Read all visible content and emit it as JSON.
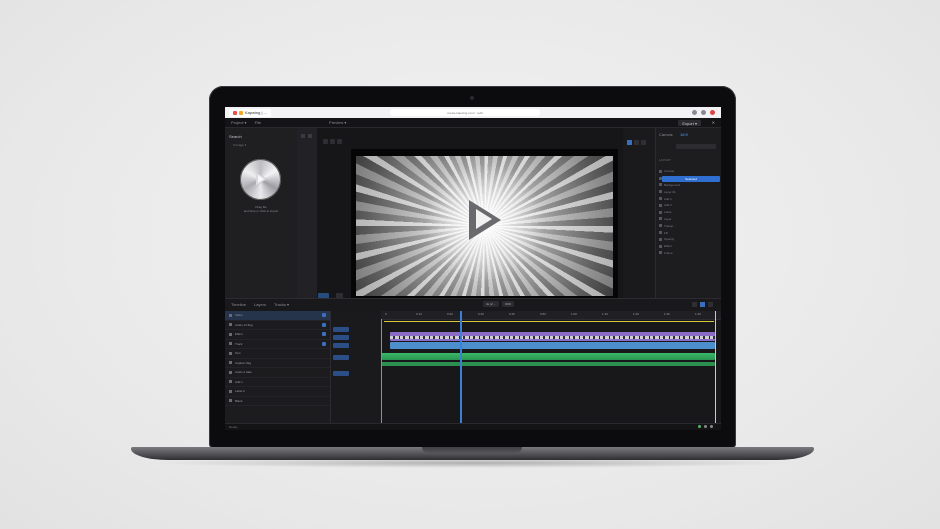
{
  "browser": {
    "tab_title": "Kapwing | ...",
    "url": "create.kapwing.com/.../edit",
    "icons": [
      "back-icon",
      "reload-icon",
      "extensions-icon",
      "profile-icon",
      "menu-icon"
    ]
  },
  "app": {
    "menu": [
      "Project ▾",
      "File",
      "Preview ▾"
    ],
    "export_label": "Export ▾",
    "close_label": "✕"
  },
  "left_panel": {
    "title": "Search",
    "subtitle": "0 Image ▾",
    "note_line1": "Drag file",
    "note_line2": "and drop or click to import"
  },
  "right_panel": {
    "top_label": "Canvas",
    "badge": "16:9",
    "section_label": "LAYOUT",
    "selected_label": "Selected",
    "rows": [
      "Canvas",
      "Element",
      "Background",
      "Layer 01",
      "Add 1",
      "Add 2",
      "Label",
      "Layer",
      "Transp...",
      "Fill",
      "Opacity",
      "Effect",
      "Frame"
    ]
  },
  "timeline": {
    "tabs": [
      "Timeline",
      "Layers",
      "Tracks ▾"
    ],
    "center": [
      "4x (2 ...",
      "0:00"
    ],
    "ticks": [
      "0",
      "0:10",
      "0:20",
      "0:30",
      "0:40",
      "0:50",
      "1:00",
      "1:10",
      "1:20",
      "1:30",
      "1:40"
    ],
    "layers": [
      "Video",
      "Audio 14 flag",
      "Effect",
      "Track",
      "Text",
      "Caption flag",
      "Audio 2 fade",
      "Add 1",
      "Label 2",
      "Blank"
    ]
  },
  "status": {
    "left": "Ready",
    "colors": {
      "accent": "#3a6fc0",
      "clip_purple": "#8a6bc5",
      "clip_blue": "#4d8fcd",
      "clip_green": "#39b866"
    }
  }
}
